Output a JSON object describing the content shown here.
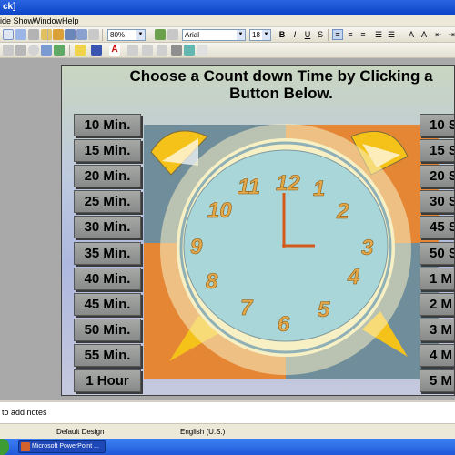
{
  "window": {
    "title": "ck]"
  },
  "menu": {
    "items": [
      "ide Show",
      "Window",
      "Help"
    ]
  },
  "toolbar": {
    "zoom": "80%",
    "font_name": "Arial",
    "font_size": "18",
    "bold": "B",
    "italic": "I",
    "underline": "U",
    "shadow": "S"
  },
  "slide": {
    "title": "Choose a Count down Time by Clicking a Button Below.",
    "left_buttons": [
      "10 Min.",
      "15 Min.",
      "20 Min.",
      "25 Min.",
      "30 Min.",
      "35 Min.",
      "40 Min.",
      "45 Min.",
      "50 Min.",
      "55 Min.",
      "1 Hour"
    ],
    "right_buttons": [
      "10 S",
      "15 S",
      "20 S",
      "30 S",
      "45 S",
      "50 S",
      "1 M",
      "2 M",
      "3 M",
      "4 M",
      "5 M"
    ],
    "clock": {
      "numbers": [
        "12",
        "1",
        "2",
        "3",
        "4",
        "5",
        "6",
        "7",
        "8",
        "9",
        "10",
        "11"
      ],
      "time_shown": "3:00",
      "colors": {
        "face": "#a9d7d9",
        "rim": "#f7f0c4",
        "orange": "#e58634",
        "slate": "#6f8d9a",
        "hands": "#d45a1a",
        "numerals": "#e3a84a"
      }
    }
  },
  "notes": {
    "placeholder": "to add notes"
  },
  "status": {
    "design": "Default Design",
    "language": "English (U.S.)"
  },
  "taskbar": {
    "app_button": "Microsoft PowerPoint ..."
  }
}
